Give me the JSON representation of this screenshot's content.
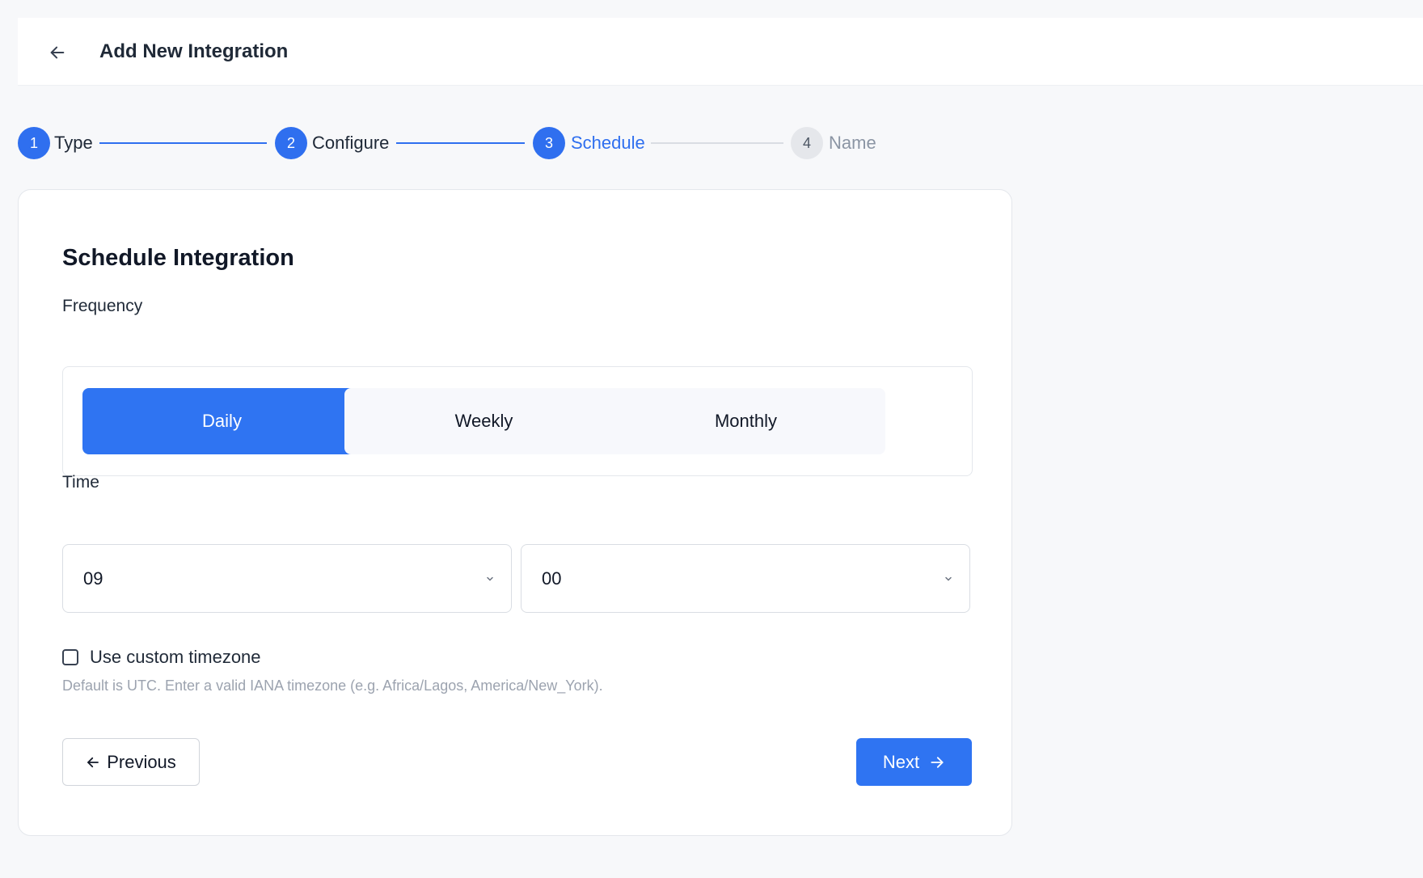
{
  "header": {
    "title": "Add New Integration",
    "back_icon": "arrow-left-icon"
  },
  "stepper": {
    "steps": [
      {
        "number": "1",
        "label": "Type",
        "state": "completed"
      },
      {
        "number": "2",
        "label": "Configure",
        "state": "completed"
      },
      {
        "number": "3",
        "label": "Schedule",
        "state": "active"
      },
      {
        "number": "4",
        "label": "Name",
        "state": "upcoming"
      }
    ]
  },
  "form": {
    "title": "Schedule Integration",
    "frequency": {
      "label": "Frequency",
      "options": [
        "Daily",
        "Weekly",
        "Monthly"
      ],
      "selected": "Daily"
    },
    "time": {
      "label": "Time",
      "hour": "09",
      "minute": "00"
    },
    "timezone": {
      "checkbox_label": "Use custom timezone",
      "checked": false,
      "hint": "Default is UTC. Enter a valid IANA timezone (e.g. Africa/Lagos, America/New_York)."
    },
    "actions": {
      "previous_label": "Previous",
      "next_label": "Next"
    }
  },
  "colors": {
    "accent": "#2f74f2",
    "inactive_step": "#e5e7eb",
    "muted_text": "#9ca3af"
  }
}
